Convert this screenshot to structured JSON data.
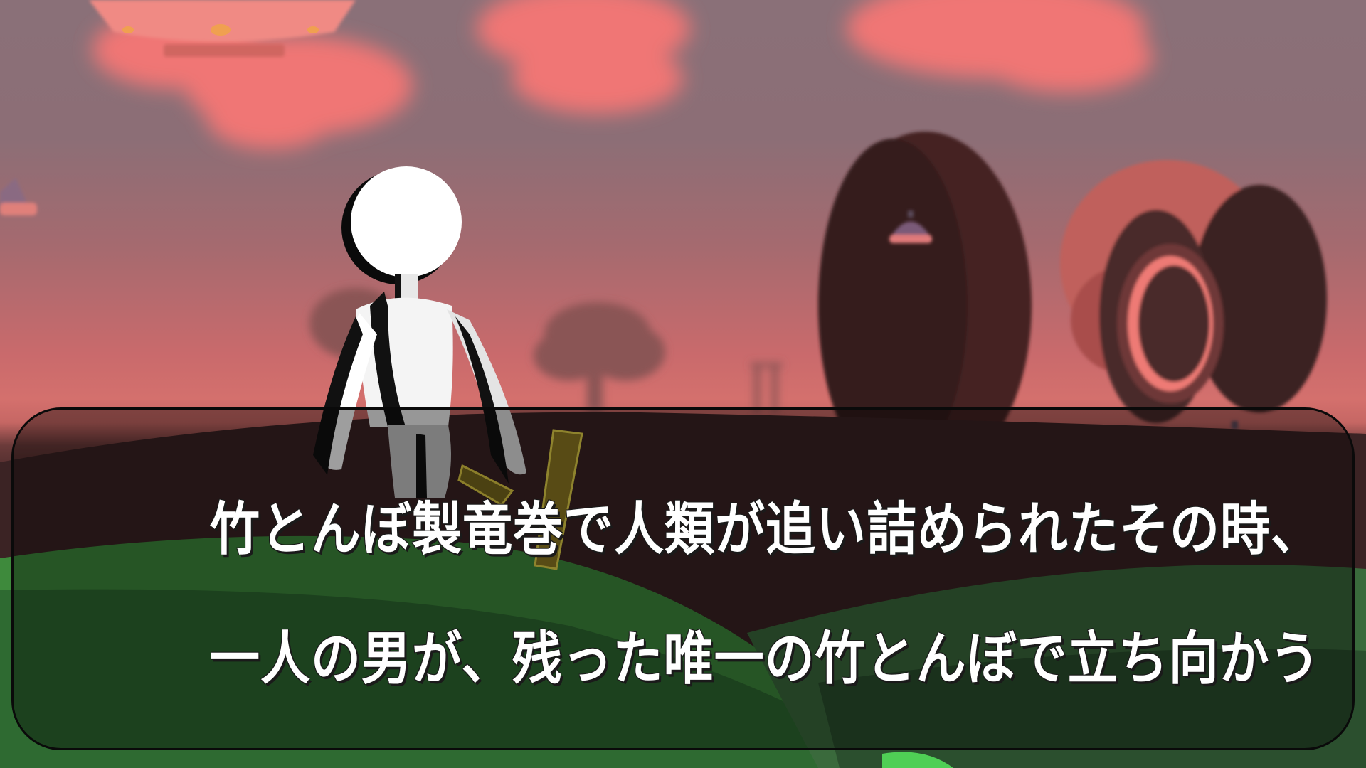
{
  "scene": {
    "colors": {
      "sky_top": "#8a7078",
      "sky_glow": "#d4706d",
      "cloud": "#f07674",
      "ground_dark": "#3b2324",
      "hill_green": "#3e8a3c",
      "hill_dark_green": "#2e6a31",
      "dialogue_box_border": "#0a0a0a",
      "text": "#ffffff"
    },
    "icons": {
      "player": "stick-figure-character",
      "held_item": "bamboo-copter-icon",
      "enemies": "ufo-icon",
      "buildings": "bamboo-copter-tower-icon"
    }
  },
  "dialogue": {
    "line_1": "竹とんぼ製竜巻で人類が追い詰められたその時、",
    "line_2": "一人の男が、残った唯一の竹とんぼで立ち向かう"
  }
}
